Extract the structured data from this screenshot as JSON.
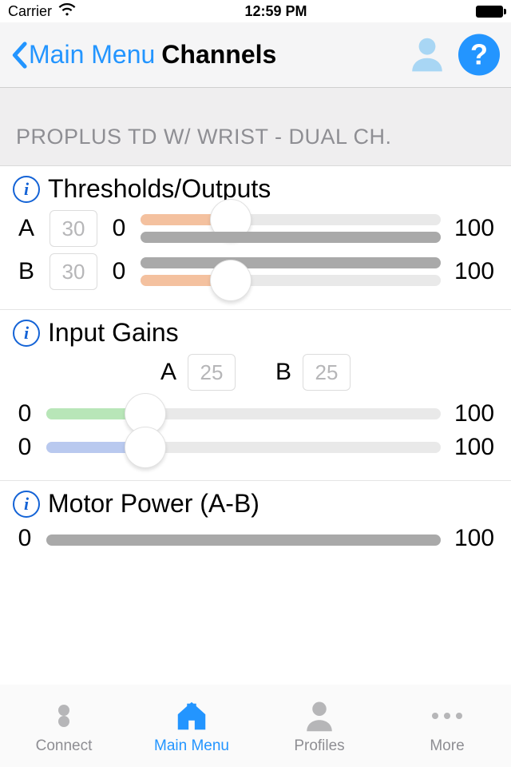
{
  "status": {
    "carrier": "Carrier",
    "time": "12:59 PM"
  },
  "nav": {
    "back": "Main Menu",
    "title": "Channels",
    "help": "?"
  },
  "device": {
    "name": "PROPLUS TD W/ WRIST - DUAL CH."
  },
  "thresholds": {
    "title": "Thresholds/Outputs",
    "min": "0",
    "max": "100",
    "a": {
      "label": "A",
      "value": "30"
    },
    "b": {
      "label": "B",
      "value": "30"
    }
  },
  "gains": {
    "title": "Input Gains",
    "min": "0",
    "max": "100",
    "a": {
      "label": "A",
      "value": "25"
    },
    "b": {
      "label": "B",
      "value": "25"
    }
  },
  "motor": {
    "title": "Motor Power (A-B)",
    "min": "0",
    "max": "100"
  },
  "tabs": {
    "connect": "Connect",
    "mainmenu": "Main Menu",
    "profiles": "Profiles",
    "more": "More"
  }
}
